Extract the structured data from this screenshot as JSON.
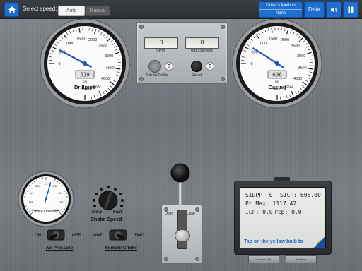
{
  "topbar": {
    "speed_label": "Select speed:",
    "speed_options": [
      "Auto",
      "Manual"
    ],
    "method_title": "Driller's Method",
    "method_value": "None",
    "data_label": "Data"
  },
  "drillpipe_gauge": {
    "title": "Drillpipe",
    "unit": "psi",
    "readout": "519",
    "ticks": [
      "0",
      "500",
      "1000",
      "1500",
      "2000",
      "2500",
      "3000",
      "3500",
      "4000",
      "4500",
      "5000"
    ],
    "value": 519,
    "max": 5000
  },
  "casing_gauge": {
    "title": "Casing",
    "unit": "psi",
    "readout": "606",
    "ticks": [
      "0",
      "500",
      "1000",
      "1500",
      "2000",
      "2500",
      "3000",
      "3500",
      "4000",
      "4500",
      "5000"
    ],
    "value": 606,
    "max": 5000
  },
  "pump_panel": {
    "spm_value": "0",
    "spm_label": "SPM",
    "strokes_value": "0",
    "strokes_label": "Total Strokes",
    "talk_label": "Talk to Driller",
    "reset_label": "Reset",
    "help": "?"
  },
  "choke_gauge": {
    "title": "Choke Operation",
    "ticks": [
      "Open",
      "1/8",
      "1/4",
      "3/8",
      "1/2",
      "5/8",
      "3/4",
      "7/8",
      "Close"
    ]
  },
  "choke_speed": {
    "slow_label": "Slow",
    "fast_label": "Fast",
    "title": "Choke Speed"
  },
  "air_switch": {
    "on_label": "ON",
    "off_label": "OFF",
    "title": "Air Pressure"
  },
  "remote_switch": {
    "one_label": "ONE",
    "two_label": "TWO",
    "title": "Remote Choke"
  },
  "lever": {
    "open_label": "Open",
    "close_label": "Close"
  },
  "monitor": {
    "sidpp": "SIDPP: 0",
    "sicp": "SICP: 606.00",
    "pc_max": "Pc Max: 1117.47",
    "icp": "ICP: 0.0",
    "rcp": "rcp: 0.0",
    "hint": "Tap on the yellow bulb to",
    "btn_left": "Record ICP",
    "btn_right": "Problem"
  }
}
